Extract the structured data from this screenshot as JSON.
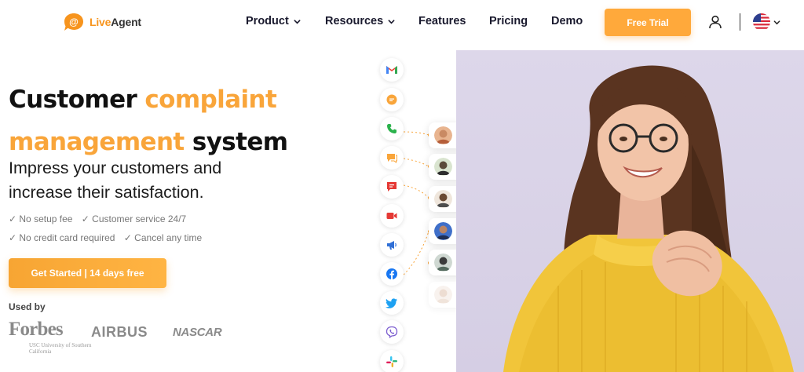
{
  "brand": {
    "logo_live": "Live",
    "logo_agent": "Agent",
    "logo_glyph": "@",
    "accent": "#f9a53a",
    "text_dark": "#111111"
  },
  "nav": {
    "items": [
      {
        "label": "Product",
        "has_dropdown": true
      },
      {
        "label": "Resources",
        "has_dropdown": true
      },
      {
        "label": "Features",
        "has_dropdown": false
      },
      {
        "label": "Pricing",
        "has_dropdown": false
      },
      {
        "label": "Demo",
        "has_dropdown": false
      }
    ],
    "cta_label": "Free Trial",
    "account_icon": "user-icon",
    "language_icon": "us-flag-icon"
  },
  "hero": {
    "title_part1": "Customer",
    "title_part2": "complaint",
    "title_part3": "management",
    "title_part4": "system",
    "subtitle": "Impress your customers and increase their satisfaction.",
    "checks": [
      "✓ No setup fee",
      "✓ Customer service 24/7",
      "✓ No credit card required",
      "✓ Cancel any time"
    ],
    "cta_label": "Get Started | 14 days free",
    "used_by_label": "Used by"
  },
  "logos": {
    "forbes": "Forbes",
    "usc": "USC University of Southern California",
    "airbus": "AIRBUS",
    "nascar": "NASCAR"
  },
  "channels": [
    "gmail-icon",
    "chat-icon",
    "phone-icon",
    "messenger-chat-icon",
    "sms-icon",
    "video-icon",
    "megaphone-icon",
    "facebook-icon",
    "twitter-icon",
    "viber-icon",
    "slack-icon"
  ],
  "ticket_cards": [
    {
      "channel": "gmail-icon"
    },
    {
      "channel": "chat-icon"
    },
    {
      "channel": "phone-icon"
    },
    {
      "channel": "facebook-icon"
    },
    {
      "channel": "slack-icon"
    },
    {
      "channel": "viber-icon"
    }
  ],
  "hero_image": "smiling-woman-in-yellow-sweater"
}
